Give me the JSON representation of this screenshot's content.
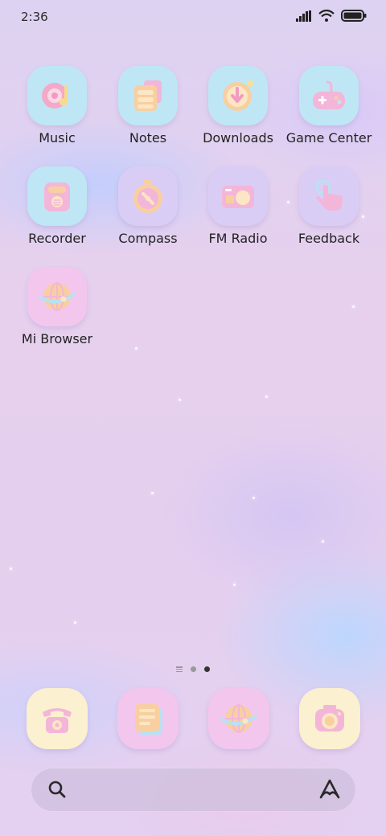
{
  "status_bar": {
    "time": "2:36"
  },
  "apps": [
    {
      "label": "Music"
    },
    {
      "label": "Notes"
    },
    {
      "label": "Downloads"
    },
    {
      "label": "Game Center"
    },
    {
      "label": "Recorder"
    },
    {
      "label": "Compass"
    },
    {
      "label": "FM Radio"
    },
    {
      "label": "Feedback"
    },
    {
      "label": "Mi Browser"
    }
  ],
  "dock": [
    {
      "icon": "phone-icon"
    },
    {
      "icon": "notes-icon"
    },
    {
      "icon": "browser-icon"
    },
    {
      "icon": "camera-icon"
    }
  ],
  "page_indicator": {
    "pages": 2,
    "active": 2
  },
  "colors": {
    "tile_blue": "#bfe6f5",
    "tile_lavender": "#d9cdf5",
    "tile_pink": "#f3c6ee",
    "tile_cream": "#fbf0cf",
    "accent_pink": "#f5a8cf",
    "accent_peach": "#f9d2a8"
  }
}
